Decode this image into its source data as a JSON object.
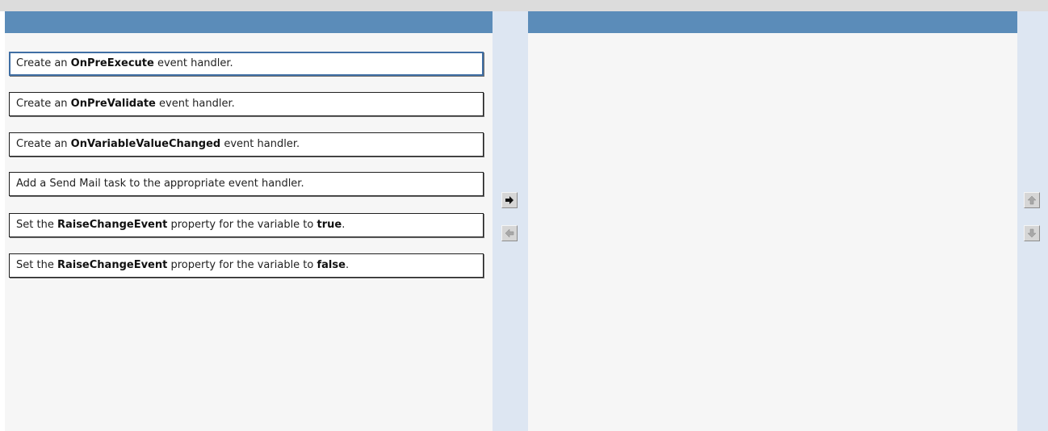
{
  "source_items": [
    {
      "pre": "Create an ",
      "bold": "OnPreExecute",
      "post": " event handler.",
      "bold2": "",
      "post2": ""
    },
    {
      "pre": "Create an ",
      "bold": "OnPreValidate",
      "post": " event handler.",
      "bold2": "",
      "post2": ""
    },
    {
      "pre": "Create an ",
      "bold": "OnVariableValueChanged",
      "post": " event handler.",
      "bold2": "",
      "post2": ""
    },
    {
      "pre": "Add a Send Mail task to the appropriate event handler.",
      "bold": "",
      "post": "",
      "bold2": "",
      "post2": ""
    },
    {
      "pre": "Set the ",
      "bold": "RaiseChangeEvent",
      "post": " property for the variable to ",
      "bold2": "true",
      "post2": "."
    },
    {
      "pre": "Set the ",
      "bold": "RaiseChangeEvent",
      "post": " property for the variable to ",
      "bold2": "false",
      "post2": "."
    }
  ],
  "selected_index": 0,
  "icons": {
    "move_right": "right-arrow-icon",
    "move_left": "left-arrow-icon",
    "move_up": "up-arrow-icon",
    "move_down": "down-arrow-icon"
  },
  "colors": {
    "header": "#5b8cb9",
    "strip": "#dde6f2",
    "selected_border": "#3f6ea4"
  }
}
